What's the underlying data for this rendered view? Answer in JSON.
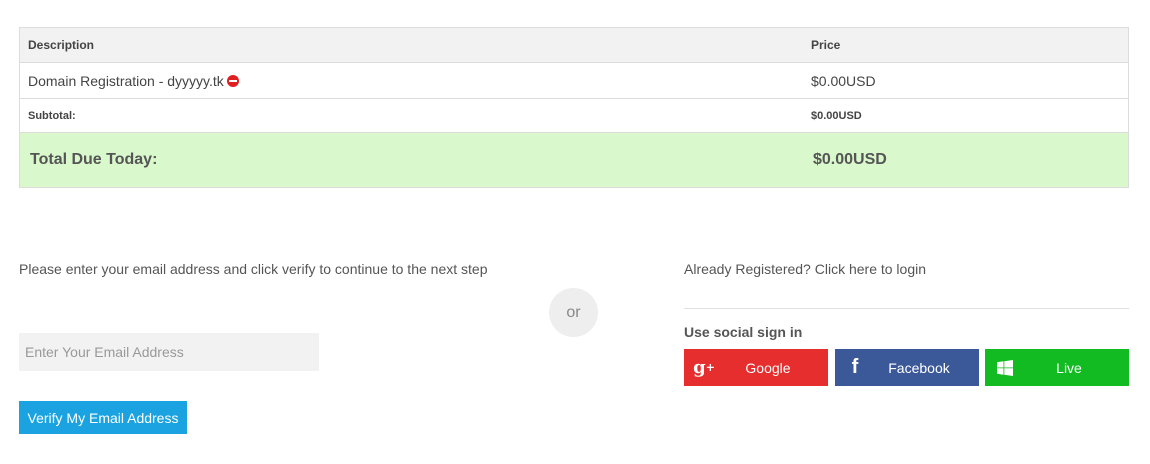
{
  "order_table": {
    "headers": {
      "description": "Description",
      "price": "Price"
    },
    "items": [
      {
        "description": "Domain Registration - dyyyyy.tk",
        "price": "$0.00USD"
      }
    ],
    "subtotal": {
      "label": "Subtotal:",
      "value": "$0.00USD"
    },
    "total": {
      "label": "Total Due Today:",
      "value": "$0.00USD"
    }
  },
  "verify": {
    "instructions": "Please enter your email address and click verify to continue to the next step",
    "email_placeholder": "Enter Your Email Address",
    "email_value": "",
    "button_label": "Verify My Email Address"
  },
  "or_label": "or",
  "login": {
    "link_text": "Already Registered? Click here to login"
  },
  "social": {
    "heading": "Use social sign in",
    "buttons": [
      {
        "label": "Google",
        "icon": "google-plus-icon",
        "color": "#e62e2e"
      },
      {
        "label": "Facebook",
        "icon": "facebook-icon",
        "color": "#3b5998"
      },
      {
        "label": "Live",
        "icon": "windows-icon",
        "color": "#12bb22"
      }
    ]
  },
  "colors": {
    "total_row_bg": "#d9f8cb",
    "verify_button": "#1aa3e0",
    "remove_icon": "#e02020"
  }
}
